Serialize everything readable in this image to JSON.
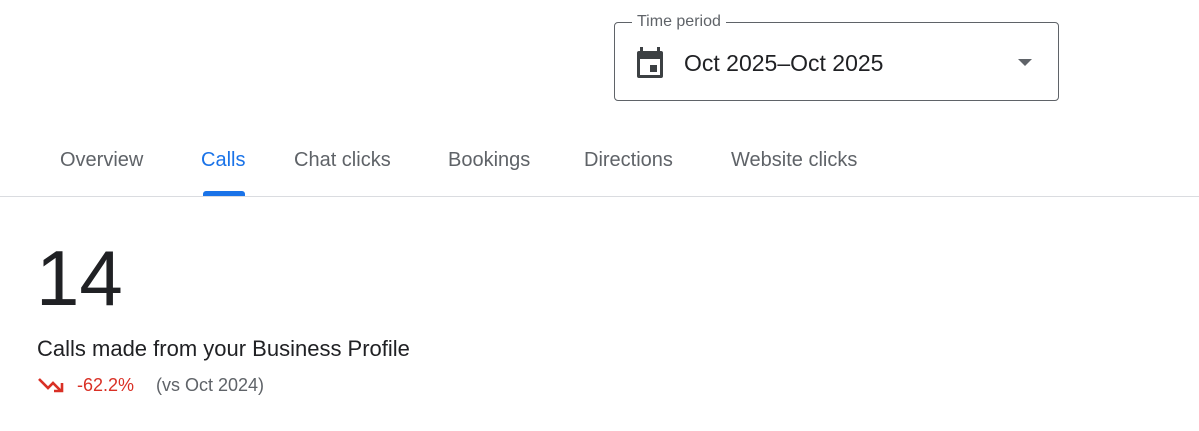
{
  "time_period": {
    "label": "Time period",
    "value": "Oct 2025–Oct 2025"
  },
  "tabs": [
    {
      "label": "Overview",
      "active": false
    },
    {
      "label": "Calls",
      "active": true
    },
    {
      "label": "Chat clicks",
      "active": false
    },
    {
      "label": "Bookings",
      "active": false
    },
    {
      "label": "Directions",
      "active": false
    },
    {
      "label": "Website clicks",
      "active": false
    }
  ],
  "metric": {
    "value": "14",
    "description": "Calls made from your Business Profile",
    "change": "-62.2%",
    "comparison": "(vs Oct 2024)"
  },
  "icons": {
    "calendar": "calendar-icon",
    "dropdown": "dropdown-arrow-icon",
    "trend": "trend-down-icon"
  },
  "colors": {
    "accent": "#1a73e8",
    "negative": "#d93025",
    "text_primary": "#202124",
    "text_secondary": "#5f6368",
    "divider": "#dadce0"
  }
}
